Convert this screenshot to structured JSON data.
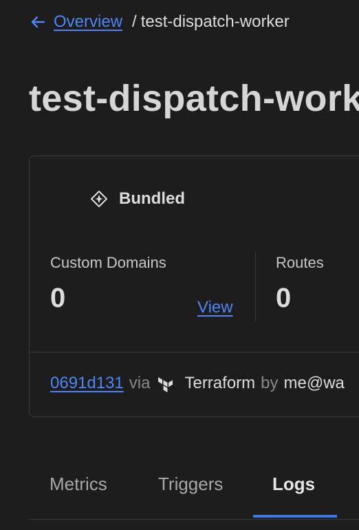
{
  "breadcrumb": {
    "back_label": "Overview",
    "separator": "/",
    "current": "test-dispatch-worker"
  },
  "page_title": "test-dispatch-worker",
  "card": {
    "usage_model": "Bundled",
    "custom_domains": {
      "label": "Custom Domains",
      "value": "0",
      "view_label": "View"
    },
    "routes": {
      "label": "Routes",
      "value": "0"
    },
    "deployment": {
      "commit": "0691d131",
      "via": "via",
      "tool": "Terraform",
      "by": "by",
      "author": "me@wa"
    }
  },
  "tabs": [
    {
      "label": "Metrics",
      "active": false
    },
    {
      "label": "Triggers",
      "active": false
    },
    {
      "label": "Logs",
      "active": true
    }
  ],
  "colors": {
    "background": "#1d1d1d",
    "link": "#4f86f7",
    "active_tab_underline": "#3b78e7",
    "border": "#3a3a3a"
  },
  "icons": {
    "back": "arrow-left-icon",
    "usage_model": "bundled-diamond-icon",
    "deploy_tool": "terraform-icon"
  }
}
